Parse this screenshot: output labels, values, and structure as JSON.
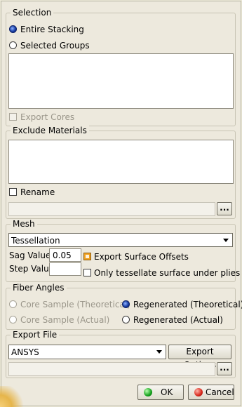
{
  "selection": {
    "legend": "Selection",
    "options": [
      {
        "label": "Entire Stacking",
        "selected": true
      },
      {
        "label": "Selected Groups",
        "selected": false
      }
    ],
    "export_cores_label": "Export Cores"
  },
  "exclude_materials": {
    "legend": "Exclude Materials",
    "rename_label": "Rename",
    "browse_label": "..."
  },
  "mesh": {
    "legend": "Mesh",
    "method_value": "Tessellation",
    "sag_label": "Sag Value",
    "sag_value": "0.05",
    "step_label": "Step Value",
    "step_value": "",
    "export_surface_offsets_label": "Export Surface Offsets",
    "only_tessellate_label": "Only tessellate surface under plies"
  },
  "fiber_angles": {
    "legend": "Fiber Angles",
    "options": [
      {
        "label": "Core Sample (Theoretical)",
        "enabled": false,
        "selected": false
      },
      {
        "label": "Regenerated (Theoretical)",
        "enabled": true,
        "selected": true
      },
      {
        "label": "Core Sample (Actual)",
        "enabled": false,
        "selected": false
      },
      {
        "label": "Regenerated (Actual)",
        "enabled": true,
        "selected": false
      }
    ]
  },
  "export_file": {
    "legend": "Export File",
    "format_value": "ANSYS",
    "export_options_label": "Export Options",
    "browse_label": "..."
  },
  "dialog": {
    "ok_label": "OK",
    "cancel_label": "Cancel"
  }
}
